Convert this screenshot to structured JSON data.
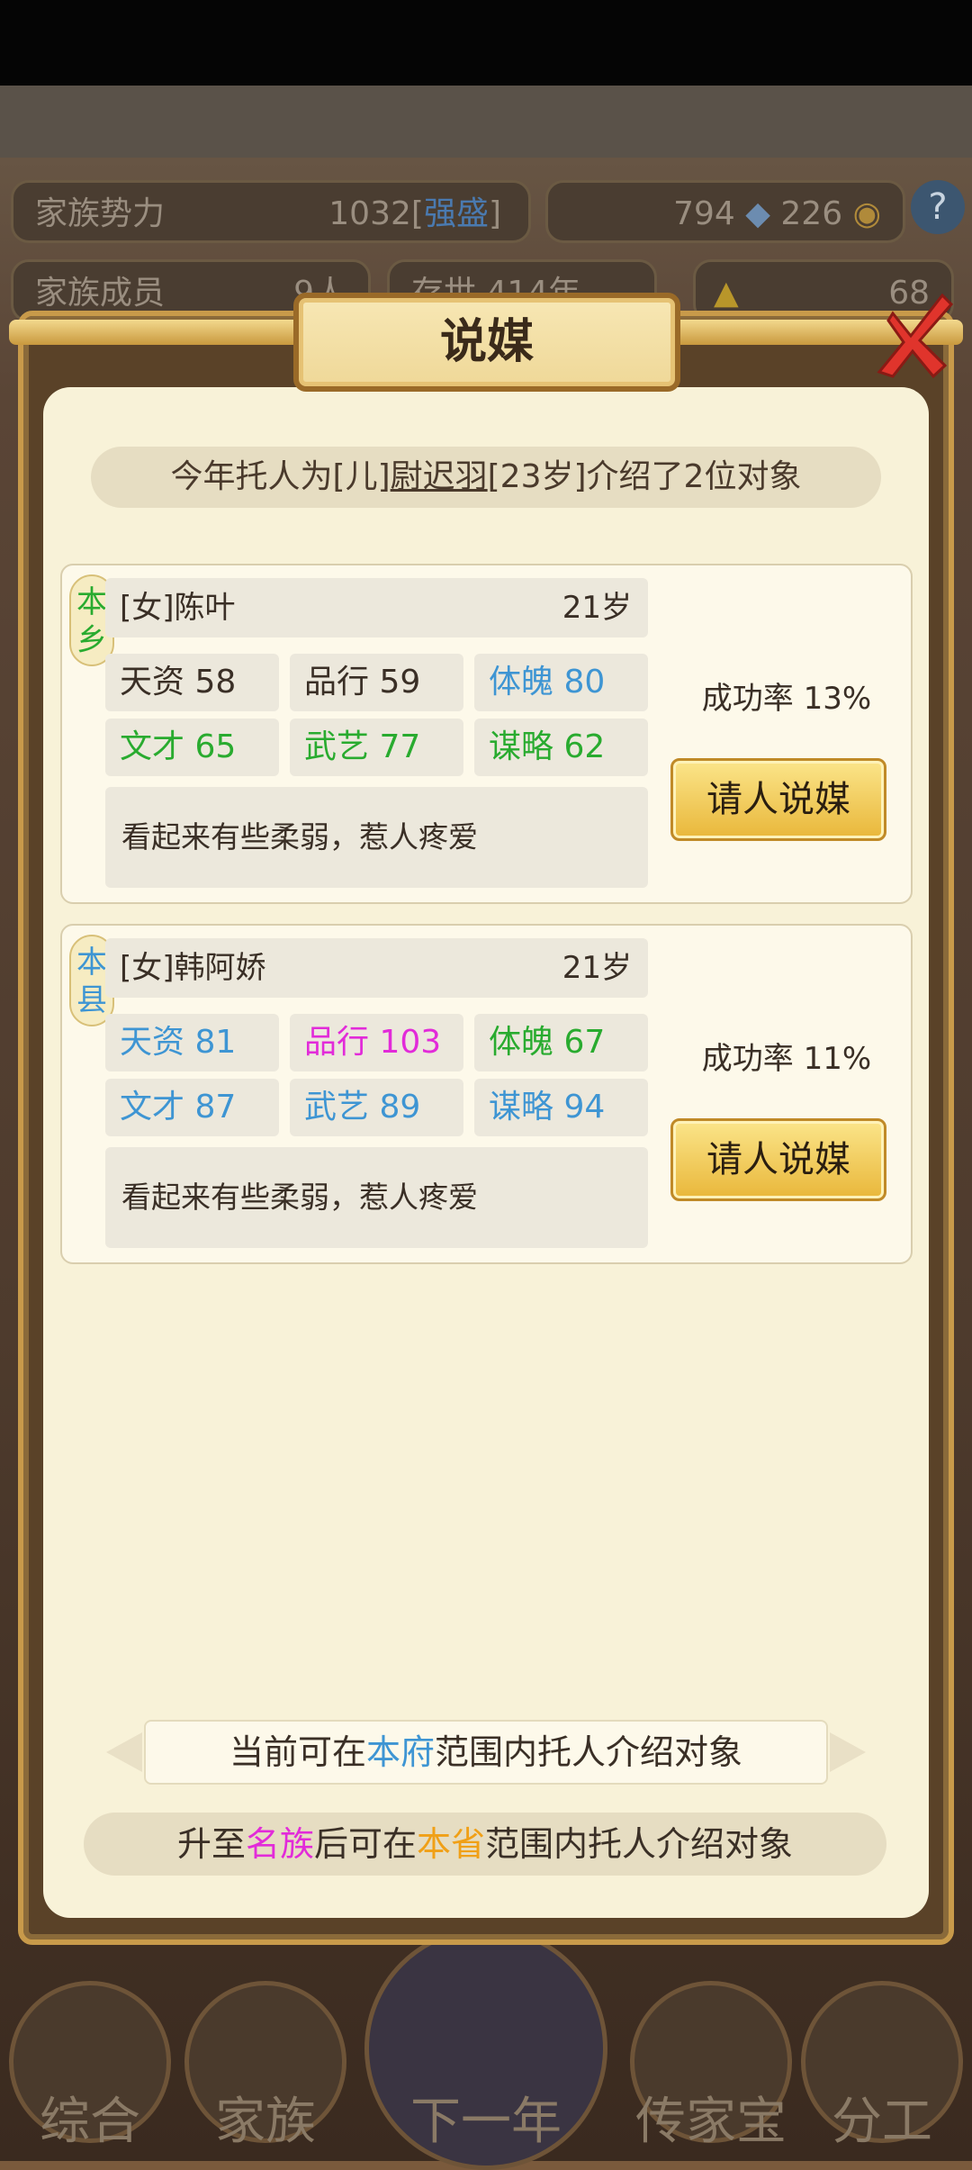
{
  "background": {
    "stats": {
      "family_power_label": "家族势力",
      "family_power_value": "1032",
      "family_power_level": "强盛",
      "currency_silver": "794",
      "currency_coin": "226",
      "members_label": "家族成员",
      "members_value": "9人",
      "generations": "存世 414年",
      "gold_value": "68"
    },
    "bottom_nav": [
      "综合",
      "家族",
      "下一年",
      "传家宝",
      "分工"
    ]
  },
  "dialog": {
    "title": "说媒",
    "intro": {
      "prefix": "今年托人为[儿]",
      "person": "尉迟羽",
      "suffix": "[23岁]介绍了2位对象"
    },
    "candidates": [
      {
        "region": "本乡",
        "region_color": "#29ab2f",
        "name": "[女]陈叶",
        "age": "21岁",
        "stats": [
          {
            "label": "天资 58",
            "color": "#3a2f26"
          },
          {
            "label": "品行 59",
            "color": "#3a2f26"
          },
          {
            "label": "体魄 80",
            "color": "#3e95d3"
          },
          {
            "label": "文才 65",
            "color": "#29ab2f"
          },
          {
            "label": "武艺 77",
            "color": "#29ab2f"
          },
          {
            "label": "谋略 62",
            "color": "#29ab2f"
          }
        ],
        "description": "看起来有些柔弱，惹人疼爱",
        "success_rate": "成功率 13%",
        "button": "请人说媒"
      },
      {
        "region": "本县",
        "region_color": "#3e95d3",
        "name": "[女]韩阿娇",
        "age": "21岁",
        "stats": [
          {
            "label": "天资 81",
            "color": "#3e95d3"
          },
          {
            "label": "品行 103",
            "color": "#e22bd9"
          },
          {
            "label": "体魄 67",
            "color": "#29ab2f"
          },
          {
            "label": "文才 87",
            "color": "#3e95d3"
          },
          {
            "label": "武艺 89",
            "color": "#3e95d3"
          },
          {
            "label": "谋略 94",
            "color": "#3e95d3"
          }
        ],
        "description": "看起来有些柔弱，惹人疼爱",
        "success_rate": "成功率 11%",
        "button": "请人说媒"
      }
    ],
    "scope": {
      "prefix": "当前可在",
      "highlight": "本府",
      "suffix": "范围内托人介绍对象"
    },
    "upgrade": {
      "p1": "升至",
      "rank": "名族",
      "p2": "后可在",
      "area": "本省",
      "p3": "范围内托人介绍对象"
    }
  }
}
